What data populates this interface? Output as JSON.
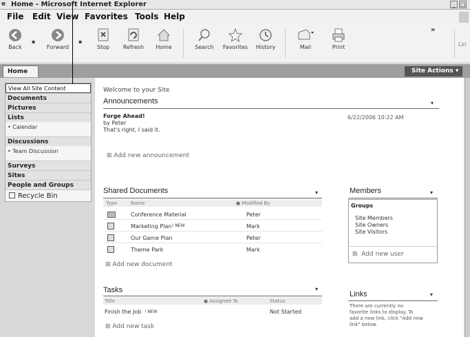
{
  "window": {
    "title": "Home - Microsoft Internet Explorer"
  },
  "menu": [
    "File",
    "Edit",
    "View",
    "Favorites",
    "Tools",
    "Help"
  ],
  "toolbar": {
    "back": "Back",
    "forward": "Forward",
    "stop": "Stop",
    "refresh": "Refresh",
    "home": "Home",
    "search": "Search",
    "favorites": "Favorites",
    "history": "History",
    "mail": "Mail",
    "print": "Print",
    "more": "»",
    "links_cut": "Lin"
  },
  "tabs": {
    "home": "Home",
    "site_actions": "Site Actions ▾"
  },
  "quicklaunch": {
    "view_all": "View All Site Content",
    "documents": "Documents",
    "pictures": "Pictures",
    "lists": "Lists",
    "calendar": "• Calendar",
    "discussions": "Discussions",
    "team_discussion": "• Team Discussion",
    "surveys": "Surveys",
    "sites": "Sites",
    "people": "People and Groups",
    "recycle": "Recycle Bin"
  },
  "welcome": "Welcome to your Site",
  "announcements": {
    "title": "Announcements",
    "item_title": "Forge Ahead!",
    "item_by": "by Peter",
    "item_body": "That's right, I said it.",
    "item_date": "6/22/2006 10:22 AM",
    "add": "Add new announcement"
  },
  "shared_docs": {
    "title": "Shared Documents",
    "col_type": "Type",
    "col_name": "Name",
    "col_modified": "Modified By",
    "rows": [
      {
        "name": "Conference Material",
        "by": "Peter",
        "new": ""
      },
      {
        "name": "Marketing Plan",
        "by": "Mark",
        "new": "! NEW"
      },
      {
        "name": "Our Game Plan",
        "by": "Peter",
        "new": ""
      },
      {
        "name": "Theme Park",
        "by": "Mark",
        "new": ""
      }
    ],
    "add": "Add new document"
  },
  "members": {
    "title": "Members",
    "groups": "Groups",
    "items": [
      "Site Members",
      "Site Owners",
      "Site Visitors"
    ],
    "add": "Add new user"
  },
  "tasks": {
    "title": "Tasks",
    "col_title": "Title",
    "col_assigned": "Assigned To",
    "col_status": "Status",
    "row_title": "Finish the Job",
    "row_new": "! NEW",
    "row_status": "Not Started",
    "add": "Add new task"
  },
  "links": {
    "title": "Links",
    "line1": "There are currently no",
    "line2": "favorite links to display. To",
    "line3": "add a new link, click \"Add new",
    "line4": "link\" below."
  },
  "chevron": "▾",
  "plus": "⊞"
}
